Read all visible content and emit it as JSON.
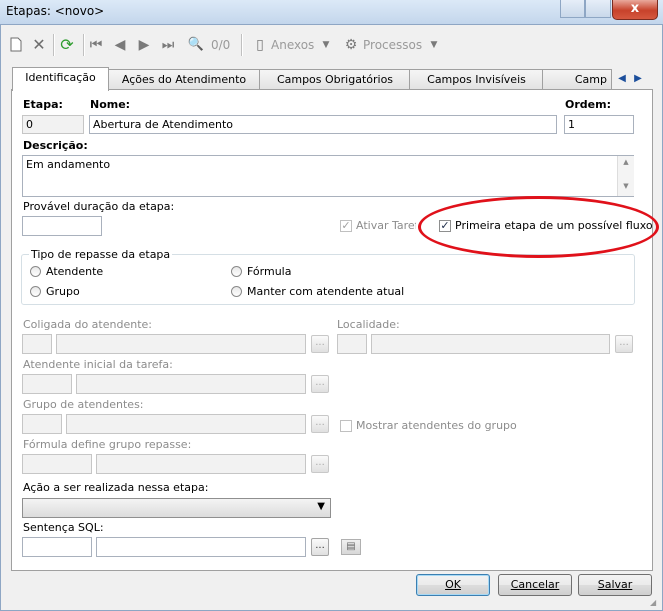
{
  "window": {
    "title": "Etapas: <novo>",
    "close_label": "x"
  },
  "toolbar": {
    "nav_counter": "0/0",
    "attachments_label": "Anexos",
    "processes_label": "Processos"
  },
  "tabs": [
    {
      "label": "Identificação"
    },
    {
      "label": "Ações do Atendimento"
    },
    {
      "label": "Campos Obrigatórios"
    },
    {
      "label": "Campos Invisíveis"
    },
    {
      "label": "Camp"
    }
  ],
  "form": {
    "stage_label": "Etapa:",
    "stage_value": "0",
    "name_label": "Nome:",
    "name_value": "Abertura de Atendimento",
    "order_label": "Ordem:",
    "order_value": "1",
    "description_label": "Descrição:",
    "description_value": "Em andamento",
    "duration_label": "Provável duração da etapa:",
    "activate_task_label": "Ativar Tarefa",
    "first_stage_label": "Primeira etapa de um possível fluxo",
    "transfer_group_label": "Tipo de repasse da etapa",
    "radio_attendant": "Atendente",
    "radio_formula": "Fórmula",
    "radio_group": "Grupo",
    "radio_keep": "Manter com atendente atual",
    "affiliate_label": "Coligada do atendente:",
    "location_label": "Localidade:",
    "initial_attendant_label": "Atendente inicial da tarefa:",
    "attendant_group_label": "Grupo de atendentes:",
    "show_group_attendants_label": "Mostrar atendentes do grupo",
    "formula_group_label": "Fórmula define grupo repasse:",
    "action_label": "Ação a ser realizada nessa etapa:",
    "sql_label": "Sentença SQL:",
    "ellipsis": "..."
  },
  "buttons": {
    "ok": "OK",
    "cancel": "Cancelar",
    "save": "Salvar"
  },
  "colors": {
    "highlight_ellipse": "#e0111a"
  }
}
